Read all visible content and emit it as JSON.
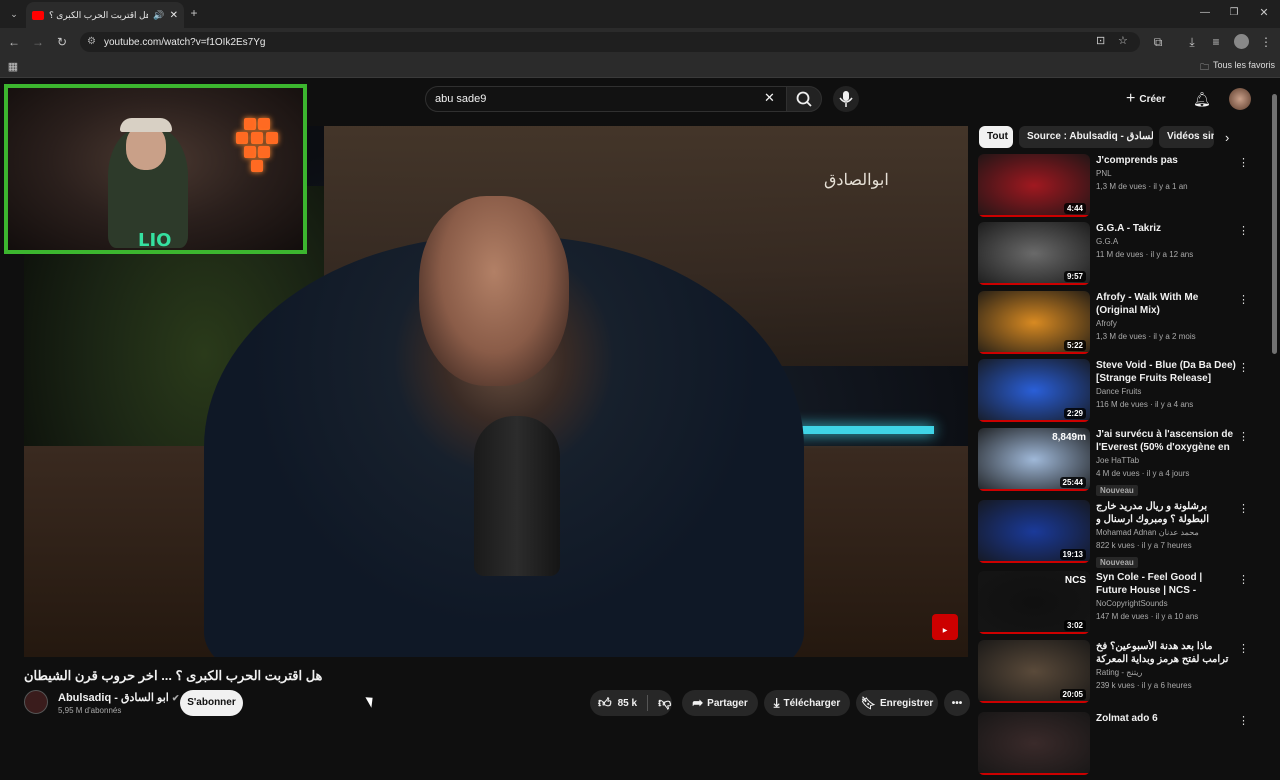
{
  "browser": {
    "tab_title": "هل اقتربت الحرب الكبرى ؟ ...",
    "url": "youtube.com/watch?v=f1OIk2Es7Yg",
    "bookmarks_label": "Tous les favoris"
  },
  "header": {
    "search_value": "abu sade9",
    "create_label": "Créer"
  },
  "video": {
    "watermark": "ابوالصادق",
    "title": "هل اقتربت الحرب الكبرى ؟ ... اخر حروب قرن الشيطان",
    "overlay_text": "LIO"
  },
  "channel": {
    "name": "Abulsadiq - ابو السادق",
    "subscribers": "5,95 M d'abonnés",
    "subscribe_label": "S'abonner"
  },
  "actions": {
    "likes": "85 k",
    "share": "Partager",
    "download": "Télécharger",
    "save": "Enregistrer"
  },
  "chips": [
    "Tout",
    "Source : Abulsadiq - ابو السادق",
    "Vidéos sin"
  ],
  "recommendations": [
    {
      "title": "J'comprends pas",
      "channel": "PNL",
      "meta": "1,3 M de vues · il y a 1 an",
      "duration": "4:44",
      "badge": "",
      "color": "#a01820"
    },
    {
      "title": "G.G.A - Takriz",
      "channel": "G.G.A",
      "meta": "11 M de vues · il y a 12 ans",
      "duration": "9:57",
      "badge": "",
      "color": "#6a6a6a"
    },
    {
      "title": "Afrofy - Walk With Me (Original Mix)",
      "channel": "Afrofy",
      "meta": "1,3 M de vues · il y a 2 mois",
      "duration": "5:22",
      "badge": "",
      "color": "#d88a22"
    },
    {
      "title": "Steve Void - Blue (Da Ba Dee) [Strange Fruits Release]",
      "channel": "Dance Fruits",
      "meta": "116 M de vues · il y a 4 ans",
      "duration": "2:29",
      "badge": "",
      "color": "#2a5fd8"
    },
    {
      "title": "J'ai survécu à l'ascension de l'Everest (50% d'oxygène en ...",
      "channel": "Joe HaTTab",
      "meta": "4 M de vues · il y a 4 jours",
      "duration": "25:44",
      "badge": "Nouveau",
      "thumb_text": "8,849m",
      "color": "#9fb8d8"
    },
    {
      "title": "برشلونة و ريال مدريد خارج البطولة ؟ ومبروك ارسنال و باريس !",
      "channel": "Mohamad Adnan محمد عدنان",
      "meta": "822 k vues · il y a 7 heures",
      "duration": "19:13",
      "badge": "Nouveau",
      "color": "#1a3a9a"
    },
    {
      "title": "Syn Cole - Feel Good | Future House | NCS - Copyright Free ...",
      "channel": "NoCopyrightSounds",
      "meta": "147 M de vues · il y a 10 ans",
      "duration": "3:02",
      "badge": "",
      "thumb_text": "NCS",
      "color": "#101010"
    },
    {
      "title": "ماذا بعد هدنة الأسبوعين؟ فخ ترامب لفتح هرمز وبداية المعركة الكبرى مع إيران",
      "channel": "Rating - ريتنج",
      "meta": "239 k vues · il y a 6 heures",
      "duration": "20:05",
      "badge": "",
      "color": "#5a4a3a"
    },
    {
      "title": "Zolmat ado 6",
      "channel": "",
      "meta": "",
      "duration": "",
      "badge": "",
      "color": "#3a2a2a"
    }
  ]
}
